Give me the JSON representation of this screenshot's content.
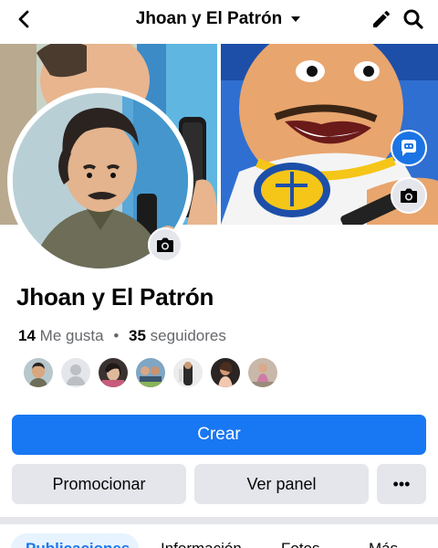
{
  "header": {
    "page_name": "Jhoan y El Patrón",
    "icons": {
      "back": "arrow-back-icon",
      "dropdown": "caret-down-icon",
      "edit": "pencil-icon",
      "search": "search-icon"
    }
  },
  "page": {
    "name": "Jhoan y El Patrón"
  },
  "stats": {
    "likes_count": "14",
    "likes_label": "Me gusta",
    "separator": "•",
    "followers_count": "35",
    "followers_label": "seguidores"
  },
  "buttons": {
    "create_label": "Crear",
    "promote_label": "Promocionar",
    "panel_label": "Ver panel",
    "more_label": "•••"
  },
  "tabs": [
    {
      "label": "Publicaciones"
    },
    {
      "label": "Información"
    },
    {
      "label": "Fotos"
    },
    {
      "label": "Más"
    }
  ],
  "colors": {
    "primary": "#1877f2",
    "secondary_bg": "#e4e6eb",
    "text": "#050505",
    "muted": "#65676b"
  }
}
